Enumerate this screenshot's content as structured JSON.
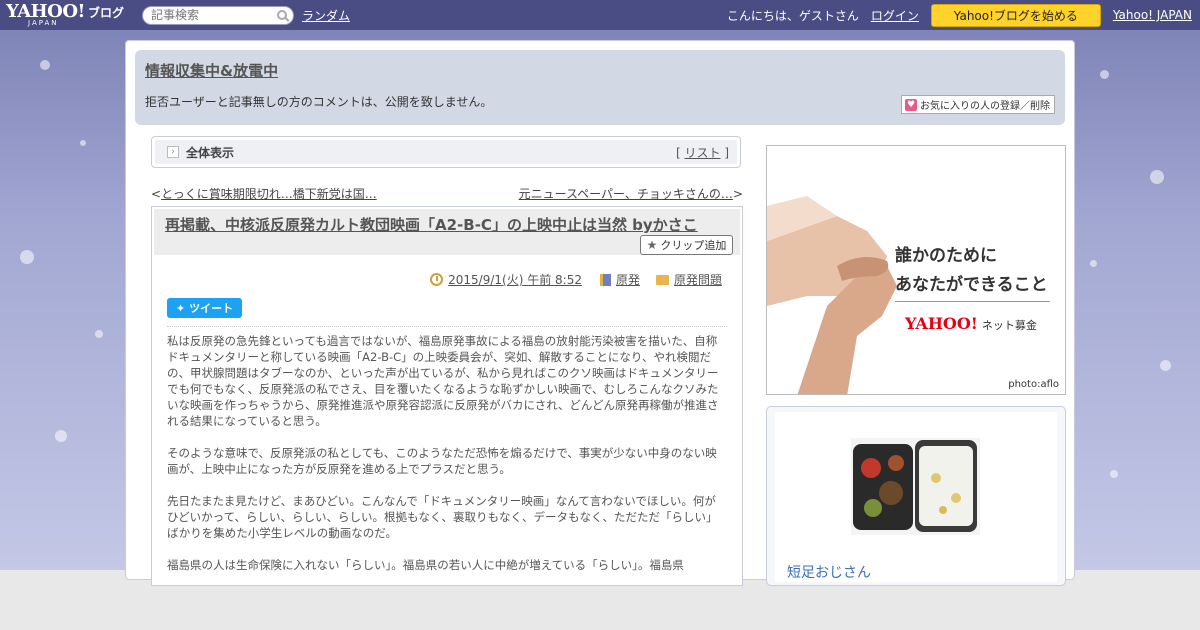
{
  "topbar": {
    "logo_main": "YAHOO!",
    "logo_sub": "JAPAN",
    "logo_blog": "ブログ",
    "search_placeholder": "記事検索",
    "random_label": "ランダム",
    "greeting": "こんにちは、ゲストさん",
    "login_label": "ログイン",
    "start_blog_label": "Yahoo!ブログを始める",
    "yahoo_japan_label": "Yahoo! JAPAN",
    "bar_color": "#4a4d83"
  },
  "blog": {
    "title": "情報収集中&放電中",
    "description": "拒否ユーザーと記事無しの方のコメントは、公開を致しません。",
    "favorite_label": "お気に入りの人の登録／削除"
  },
  "viewbar": {
    "label": "全体表示",
    "list_prefix": "[",
    "list_label": "リスト",
    "list_suffix": "]"
  },
  "nav": {
    "prev_prefix": "<",
    "prev_label": "とっくに賞味期限切れ…橋下新党は国…",
    "next_label": "元ニュースペーパー、チョッキさんの…",
    "next_suffix": ">"
  },
  "article": {
    "title": "再掲載、中核派反原発カルト教団映画「A2-B-C」の上映中止は当然 byかさこ",
    "clip_label": "クリップ追加",
    "date": "2015/9/1(火) 午前 8:52",
    "category": "原発",
    "folder": "原発問題",
    "tweet_label": "ツイート",
    "paragraphs": [
      "私は反原発の急先鋒といっても過言ではないが、福島原発事故による福島の放射能汚染被害を描いた、自称ドキュメンタリーと称している映画「A2-B-C」の上映委員会が、突如、解散することになり、やれ検閲だの、甲状腺問題はタブーなのか、といった声が出ているが、私から見ればこのクソ映画はドキュメンタリーでも何でもなく、反原発派の私でさえ、目を覆いたくなるような恥ずかしい映画で、むしろこんなクソみたいな映画を作っちゃうから、原発推進派や原発容認派に反原発がバカにされ、どんどん原発再稼働が推進される結果になっていると思う。",
      "そのような意味で、反原発派の私としても、このようなただ恐怖を煽るだけで、事実が少ない中身のない映画が、上映中止になった方が反原発を進める上でプラスだと思う。",
      "先日たまたま見たけど、まあひどい。こんなんで「ドキュメンタリー映画」なんて言わないでほしい。何がひどいかって、らしい、らしい、らしい。根拠もなく、裏取りもなく、データもなく、ただただ「らしい」ばかりを集めた小学生レベルの動画なのだ。",
      "福島県の人は生命保険に入れない「らしい」。福島県の若い人に中絶が増えている「らしい」。福島県"
    ]
  },
  "ad": {
    "line1": "誰かのために",
    "line2": "あなたができること",
    "logo": "YAHOO!",
    "logo_suffix": "ネット募金",
    "credit": "photo:aflo"
  },
  "profile": {
    "name": "短足おじさん"
  }
}
